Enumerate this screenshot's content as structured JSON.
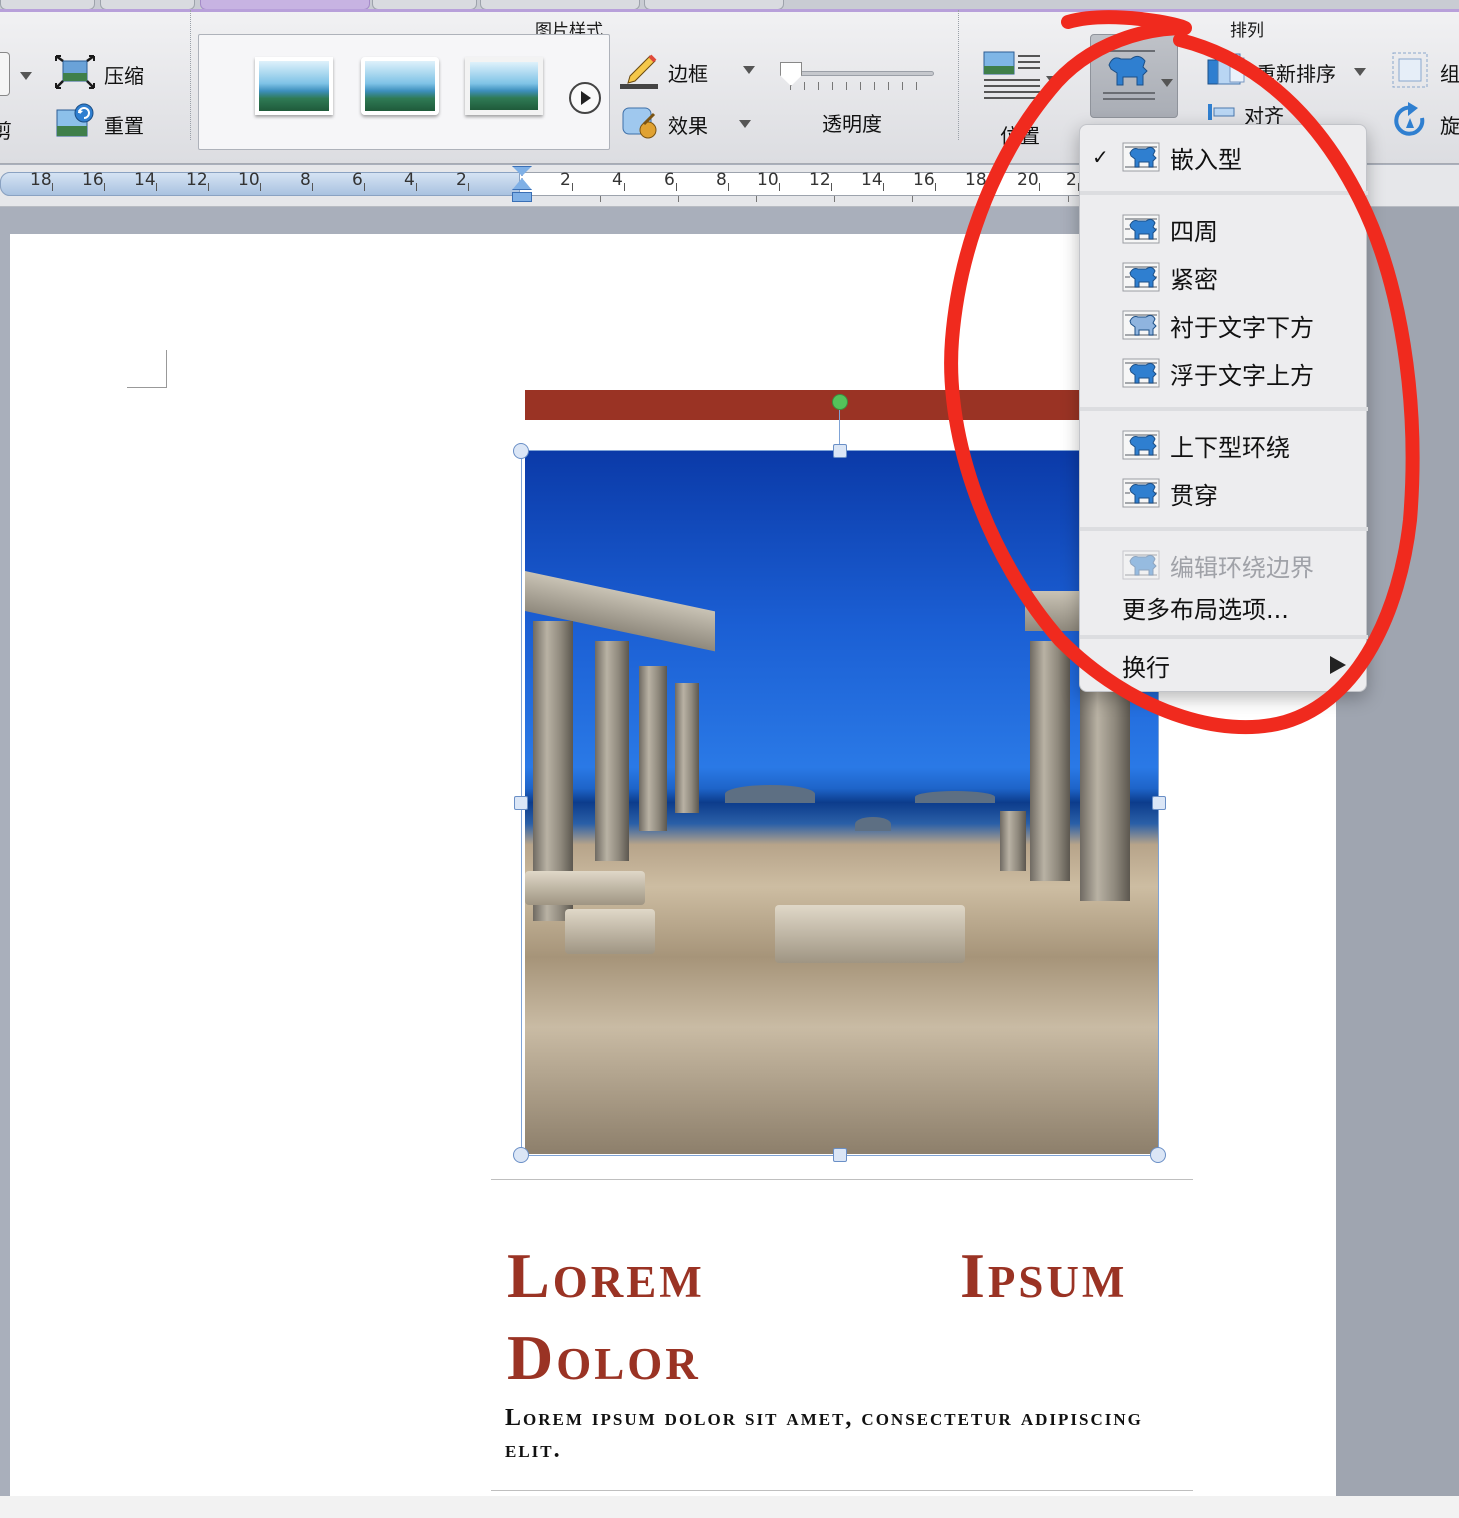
{
  "ribbon": {
    "left_labels": {
      "compress": "压缩",
      "reset": "重置",
      "crop_partial": "剪"
    },
    "picture_styles": {
      "title": "图片样式",
      "border": "边框",
      "effects": "效果",
      "transparency": "透明度"
    },
    "arrange": {
      "title": "排列",
      "position": "位置",
      "reorder": "重新排序",
      "align_partial": "对齐",
      "group_partial": "组",
      "rotate_partial": "旋"
    }
  },
  "ruler": {
    "labels": [
      "18",
      "16",
      "14",
      "12",
      "10",
      "8",
      "6",
      "4",
      "2",
      "2",
      "4",
      "6",
      "8",
      "10",
      "12",
      "14",
      "16",
      "18",
      "20",
      "2"
    ]
  },
  "wrap_menu": {
    "inline": "嵌入型",
    "square": "四周",
    "tight": "紧密",
    "behind_text": "衬于文字下方",
    "in_front_text": "浮于文字上方",
    "top_bottom": "上下型环绕",
    "through": "贯穿",
    "edit_wrap_boundary": "编辑环绕边界",
    "more_layout_options": "更多布局选项...",
    "line_break": "换行",
    "checked_item": "嵌入型"
  },
  "document": {
    "heading_line1_word1": "Lorem",
    "heading_line1_word2": "Ipsum",
    "heading_line2": "Dolor",
    "subtitle": "Lorem ipsum dolor sit amet, consectetur adipiscing elit."
  },
  "colors": {
    "accent": "#9a3324",
    "annotation": "#f02a1e"
  }
}
